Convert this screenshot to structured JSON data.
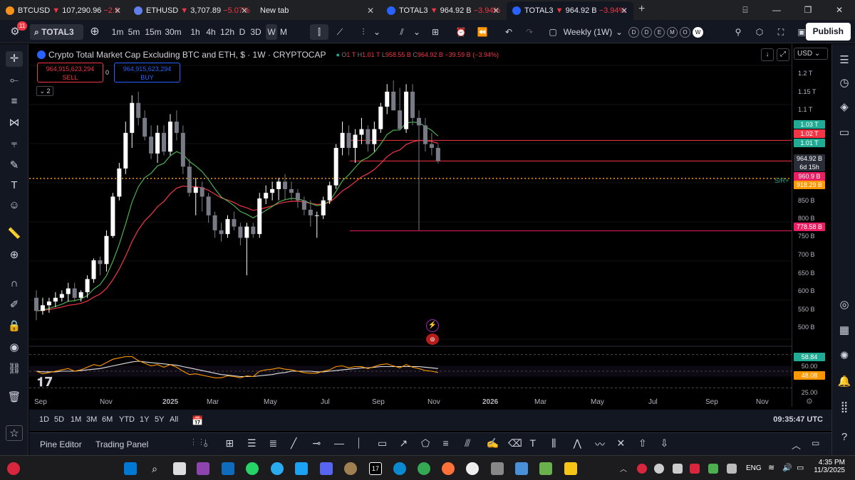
{
  "browser": {
    "tabs": [
      {
        "symbol": "BTCUSD",
        "arrow": "▼",
        "price": "107,290.96",
        "change": "−2.9",
        "icon_color": "#f7931a"
      },
      {
        "symbol": "ETHUSD",
        "arrow": "▼",
        "price": "3,707.89",
        "change": "−5.07%",
        "icon_color": "#627eea"
      },
      {
        "symbol": "New tab",
        "arrow": "",
        "price": "",
        "change": "",
        "icon_color": ""
      },
      {
        "symbol": "TOTAL3",
        "arrow": "▼",
        "price": "964.92 B",
        "change": "−3.94%",
        "icon_color": "#2962ff"
      },
      {
        "symbol": "TOTAL3",
        "arrow": "▼",
        "price": "964.92 B",
        "change": "−3.94%",
        "icon_color": "#2962ff"
      }
    ],
    "new_tab_symbol": "+",
    "window_controls": [
      "⌸",
      "—",
      "❐",
      "✕"
    ]
  },
  "toolbar": {
    "notification_count": "11",
    "symbol": "TOTAL3",
    "intervals": [
      "1m",
      "5m",
      "15m",
      "30m",
      "1h",
      "4h",
      "12h",
      "D",
      "3D",
      "W",
      "M"
    ],
    "selected_interval": "W",
    "layout_label": "Weekly (1W)",
    "session_circles": [
      "D",
      "D",
      "E",
      "M",
      "O",
      "W"
    ],
    "publish_label": "Publish"
  },
  "legend": {
    "title": "Crypto Total Market Cap Excluding BTC and ETH, $ · 1W · CRYPTOCAP",
    "open": "1 T",
    "high": "1.01 T",
    "low": "958.55 B",
    "close": "964.92 B",
    "change": "−39.59 B (−3.94%)",
    "indicator_count": "2"
  },
  "orders": {
    "sell_price": "964,915,623,294",
    "sell_label": "SELL",
    "spread": "0",
    "buy_price": "964,915,623,294",
    "buy_label": "BUY"
  },
  "currency": "USD",
  "price_scale": [
    "1.2 T",
    "1.15 T",
    "1.1 T",
    "850 B",
    "800 B",
    "750 B",
    "700 B",
    "650 B",
    "600 B",
    "550 B",
    "500 B"
  ],
  "price_tags": [
    {
      "text": "1.03 T",
      "color": "#22ab94"
    },
    {
      "text": "1.02 T",
      "color": "#f23645"
    },
    {
      "text": "1.01 T",
      "color": "#22ab94"
    },
    {
      "text": "964.92 B",
      "color": "#2a2e39"
    },
    {
      "text": "6d 15h",
      "color": "#2a2e39"
    },
    {
      "text": "960.9 B",
      "color": "#e91e63"
    },
    {
      "text": "918.29 B",
      "color": "#ff9800"
    },
    {
      "text": "778.58 B",
      "color": "#e91e63"
    }
  ],
  "sr_label": "S/R+",
  "rsi_scale": [
    {
      "text": "58.84",
      "color": "#22ab94"
    },
    {
      "text": "50.00",
      "color": "#000000"
    },
    {
      "text": "48.08",
      "color": "#ff9800"
    },
    {
      "text": "25.00",
      "color": "#000000"
    }
  ],
  "time_axis": [
    "Sep",
    "Nov",
    "2025",
    "Mar",
    "May",
    "Jul",
    "Sep",
    "Nov",
    "2026",
    "Mar",
    "May",
    "Jul",
    "Sep",
    "Nov"
  ],
  "range_buttons": [
    "1D",
    "5D",
    "1M",
    "3M",
    "6M",
    "YTD",
    "1Y",
    "5Y",
    "All"
  ],
  "clock": "09:35:47 UTC",
  "bottom_tabs": [
    "Pine Editor",
    "Trading Panel"
  ],
  "taskbar": {
    "language": "ENG",
    "time": "4:35 PM",
    "date": "11/3/2025"
  },
  "chart_data": {
    "type": "candlestick",
    "title": "Crypto Total Market Cap Excluding BTC and ETH",
    "interval": "1W",
    "units": "USD (billions)",
    "x": [
      "2024-08-19",
      "2024-08-26",
      "2024-09-02",
      "2024-09-09",
      "2024-09-16",
      "2024-09-23",
      "2024-09-30",
      "2024-10-07",
      "2024-10-14",
      "2024-10-21",
      "2024-10-28",
      "2024-11-04",
      "2024-11-11",
      "2024-11-18",
      "2024-11-25",
      "2024-12-02",
      "2024-12-09",
      "2024-12-16",
      "2024-12-23",
      "2024-12-30",
      "2025-01-06",
      "2025-01-13",
      "2025-01-20",
      "2025-01-27",
      "2025-02-03",
      "2025-02-10",
      "2025-02-17",
      "2025-02-24",
      "2025-03-03",
      "2025-03-10",
      "2025-03-17",
      "2025-03-24",
      "2025-03-31",
      "2025-04-07",
      "2025-04-14",
      "2025-04-21",
      "2025-04-28",
      "2025-05-05",
      "2025-05-12",
      "2025-05-19",
      "2025-05-26",
      "2025-06-02",
      "2025-06-09",
      "2025-06-16",
      "2025-06-23",
      "2025-06-30",
      "2025-07-07",
      "2025-07-14",
      "2025-07-21",
      "2025-07-28",
      "2025-08-04",
      "2025-08-11",
      "2025-08-18",
      "2025-08-25",
      "2025-09-01",
      "2025-09-08",
      "2025-09-15",
      "2025-09-22",
      "2025-09-29",
      "2025-10-06",
      "2025-10-13",
      "2025-10-20",
      "2025-10-27",
      "2025-11-03"
    ],
    "open": [
      600,
      565,
      580,
      590,
      600,
      610,
      625,
      600,
      615,
      650,
      700,
      690,
      765,
      870,
      945,
      1040,
      1120,
      1080,
      1030,
      985,
      1040,
      990,
      1070,
      1040,
      950,
      880,
      895,
      870,
      820,
      780,
      770,
      810,
      790,
      760,
      790,
      770,
      865,
      880,
      890,
      910,
      890,
      880,
      860,
      835,
      820,
      820,
      860,
      900,
      1000,
      1040,
      1000,
      1035,
      1050,
      1010,
      1050,
      1110,
      1150,
      1100,
      1050,
      1150,
      1080,
      1060,
      1010,
      1000
    ],
    "high": [
      620,
      600,
      600,
      615,
      620,
      640,
      640,
      620,
      660,
      705,
      710,
      780,
      880,
      960,
      1070,
      1140,
      1150,
      1100,
      1060,
      1060,
      1060,
      1090,
      1100,
      1060,
      970,
      920,
      910,
      880,
      830,
      800,
      820,
      830,
      800,
      800,
      800,
      880,
      900,
      910,
      920,
      930,
      910,
      890,
      870,
      860,
      830,
      870,
      910,
      1010,
      1070,
      1060,
      1050,
      1080,
      1060,
      1070,
      1120,
      1170,
      1180,
      1160,
      1170,
      1170,
      1100,
      1080,
      1040,
      1010
    ],
    "high_note": "",
    "low": [
      540,
      555,
      560,
      575,
      590,
      590,
      590,
      590,
      600,
      640,
      660,
      670,
      760,
      860,
      930,
      1000,
      1060,
      1020,
      970,
      960,
      980,
      980,
      1020,
      930,
      870,
      820,
      830,
      800,
      760,
      750,
      760,
      780,
      740,
      660,
      760,
      760,
      850,
      860,
      860,
      860,
      860,
      840,
      820,
      790,
      760,
      810,
      850,
      890,
      980,
      980,
      960,
      1010,
      990,
      990,
      1040,
      1090,
      1100,
      1050,
      1040,
      1060,
      780,
      990,
      980,
      958.55
    ],
    "close": [
      565,
      580,
      590,
      600,
      610,
      625,
      600,
      615,
      650,
      700,
      690,
      765,
      870,
      945,
      1040,
      1120,
      1080,
      1030,
      985,
      1040,
      990,
      1070,
      1040,
      950,
      880,
      895,
      870,
      820,
      780,
      770,
      810,
      790,
      760,
      790,
      770,
      865,
      880,
      890,
      910,
      890,
      880,
      860,
      835,
      820,
      820,
      860,
      900,
      1000,
      1040,
      1000,
      1035,
      1050,
      1010,
      1050,
      1110,
      1150,
      1100,
      1050,
      1150,
      1080,
      1060,
      1010,
      1000,
      964.92
    ],
    "ylim": [
      480,
      1220
    ],
    "horizontal_lines": [
      {
        "value": 1020,
        "color": "#f23645"
      },
      {
        "value": 964.92,
        "color": "#f23645"
      },
      {
        "value": 918.29,
        "color": "#ff9800",
        "style": "dotted"
      },
      {
        "value": 778.58,
        "color": "#e91e63"
      }
    ],
    "rsi": {
      "levels": [
        25,
        50,
        75
      ],
      "ylim": [
        20,
        80
      ],
      "rsi_values": [
        50,
        46,
        48,
        50,
        52,
        54,
        50,
        52,
        56,
        60,
        58,
        63,
        68,
        70,
        72,
        72,
        66,
        62,
        58,
        60,
        56,
        60,
        56,
        50,
        45,
        46,
        44,
        42,
        40,
        40,
        43,
        42,
        40,
        43,
        42,
        50,
        52,
        53,
        55,
        53,
        52,
        50,
        48,
        47,
        47,
        50,
        52,
        57,
        58,
        55,
        57,
        57,
        54,
        57,
        60,
        61,
        58,
        55,
        60,
        56,
        54,
        51,
        50,
        48.08
      ],
      "ma_values": [
        50,
        49,
        49,
        49,
        50,
        50,
        50,
        51,
        52,
        53,
        54,
        56,
        58,
        60,
        62,
        64,
        65,
        64,
        63,
        62,
        61,
        60,
        59,
        57,
        55,
        53,
        51,
        49,
        47,
        45,
        44,
        43,
        42,
        42,
        42,
        43,
        44,
        45,
        47,
        48,
        50,
        50,
        50,
        50,
        49,
        49,
        50,
        51,
        52,
        53,
        54,
        55,
        55,
        56,
        57,
        57,
        57,
        57,
        57,
        57,
        57,
        56,
        55,
        54
      ]
    }
  }
}
